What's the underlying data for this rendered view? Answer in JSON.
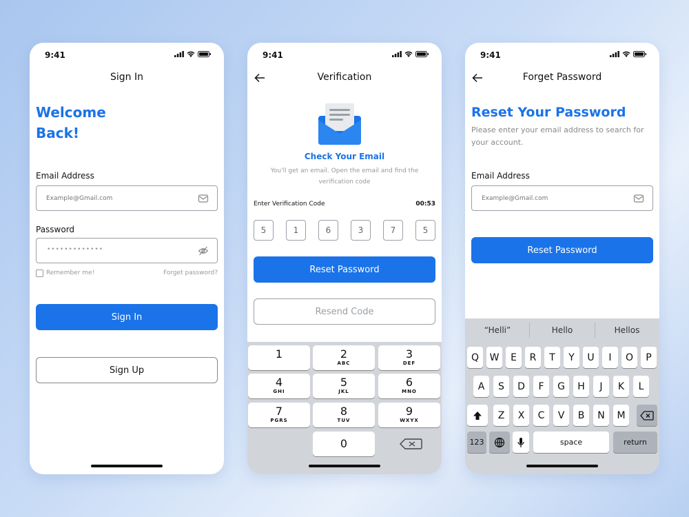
{
  "status": {
    "time": "9:41"
  },
  "signin": {
    "nav_title": "Sign In",
    "welcome_line1": "Welcome",
    "welcome_line2": "Back!",
    "email_label": "Email Address",
    "email_placeholder": "Example@Gmail.com",
    "password_label": "Password",
    "password_value": "•••••••••••••",
    "remember_label": "Remember me!",
    "forget_link": "Forget password?",
    "signin_button": "Sign In",
    "signup_button": "Sign Up"
  },
  "verification": {
    "nav_title": "Verification",
    "check_title": "Check Your Email",
    "check_desc": "You'll get an email. Open the email and find the verification code",
    "code_label": "Enter Verification Code",
    "timer": "00:53",
    "code_digits": [
      "5",
      "1",
      "6",
      "3",
      "7",
      "5"
    ],
    "reset_button": "Reset Password",
    "resend_button": "Resend Code",
    "keypad": [
      {
        "digit": "1",
        "letters": ""
      },
      {
        "digit": "2",
        "letters": "ABC"
      },
      {
        "digit": "3",
        "letters": "DEF"
      },
      {
        "digit": "4",
        "letters": "GHI"
      },
      {
        "digit": "5",
        "letters": "JKL"
      },
      {
        "digit": "6",
        "letters": "MNO"
      },
      {
        "digit": "7",
        "letters": "PGRS"
      },
      {
        "digit": "8",
        "letters": "TUV"
      },
      {
        "digit": "9",
        "letters": "WXYX"
      },
      {
        "digit": "0",
        "letters": ""
      }
    ]
  },
  "forget": {
    "nav_title": "Forget Password",
    "title": "Reset Your Password",
    "desc": "Please enter your email address to search for your account.",
    "email_label": "Email Address",
    "email_placeholder": "Example@Gmail.com",
    "reset_button": "Reset Password",
    "suggestions": [
      "“Helli”",
      "Hello",
      "Hellos"
    ],
    "row1": [
      "Q",
      "W",
      "E",
      "R",
      "T",
      "Y",
      "U",
      "I",
      "O",
      "P"
    ],
    "row2": [
      "A",
      "S",
      "D",
      "F",
      "G",
      "H",
      "J",
      "K",
      "L"
    ],
    "row3": [
      "Z",
      "X",
      "C",
      "V",
      "B",
      "N",
      "M"
    ],
    "key_123": "123",
    "key_space": "space",
    "key_return": "return"
  },
  "colors": {
    "accent": "#1a73e8",
    "keyboard_bg": "#d1d4d9"
  }
}
